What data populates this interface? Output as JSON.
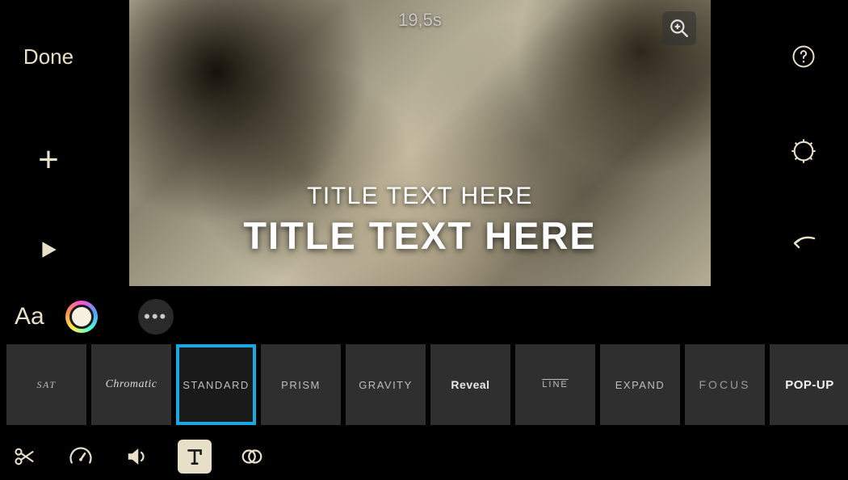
{
  "header": {
    "done_label": "Done",
    "add_label": "+",
    "play_label": "▶"
  },
  "preview": {
    "duration": "19,5s",
    "title_small": "TITLE TEXT HERE",
    "title_large": "TITLE TEXT HERE"
  },
  "format_bar": {
    "aa_label": "Aa",
    "more_label": "•••"
  },
  "title_styles": {
    "selected_index": 2,
    "items": [
      {
        "label": "SAT",
        "variant": "first"
      },
      {
        "label": "Chromatic",
        "variant": "chromatic"
      },
      {
        "label": "STANDARD",
        "variant": "standard"
      },
      {
        "label": "PRISM",
        "variant": "prism"
      },
      {
        "label": "GRAVITY",
        "variant": "gravity"
      },
      {
        "label": "Reveal",
        "variant": "reveal"
      },
      {
        "label": "LINE",
        "variant": "line"
      },
      {
        "label": "EXPAND",
        "variant": "expand"
      },
      {
        "label": "FOCUS",
        "variant": "focus"
      },
      {
        "label": "POP-UP",
        "variant": "popup"
      }
    ]
  },
  "bottom_tools": {
    "active_index": 3,
    "items": [
      {
        "name": "cut-tool",
        "icon": "scissors"
      },
      {
        "name": "speed-tool",
        "icon": "speedometer"
      },
      {
        "name": "volume-tool",
        "icon": "speaker"
      },
      {
        "name": "text-tool",
        "icon": "text"
      },
      {
        "name": "filter-tool",
        "icon": "circles"
      }
    ]
  },
  "icons": {
    "help": "help-icon",
    "settings": "gear-icon",
    "undo": "undo-icon",
    "zoom": "zoom-in-icon"
  }
}
